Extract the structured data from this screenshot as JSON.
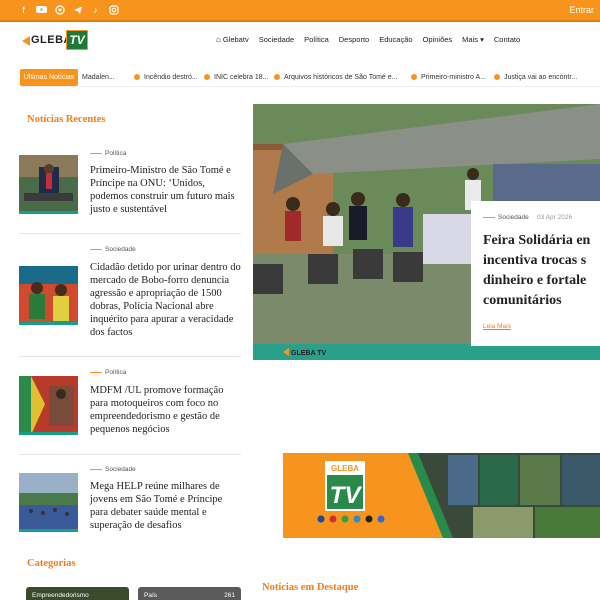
{
  "topbar": {
    "social_icons": [
      "facebook-icon",
      "youtube-icon",
      "whatsapp-icon",
      "telegram-icon",
      "tiktok-icon",
      "instagram-icon"
    ],
    "login": "Entrar"
  },
  "logo": {
    "word": "GLEBA",
    "tv": "TV"
  },
  "nav": {
    "items": [
      "Glebatv",
      "Sociedade",
      "Política",
      "Desporto",
      "Educação",
      "Opiniões",
      "Mais ▾",
      "Contato"
    ]
  },
  "ticker": {
    "label": "Últimas Notícias",
    "items": [
      "Madalen...",
      "Incêndio destró...",
      "INIC celebra 18...",
      "Arquivos históricos de São Tomé e...",
      "Primeiro-ministro A...",
      "Justiça vai ao encontr..."
    ]
  },
  "sidebar": {
    "recent_title": "Notícias Recentes",
    "items": [
      {
        "category": "Política",
        "title": "Primeiro-Ministro de São Tomé e Príncipe na ONU: ‘Unidos, podemos construir um futuro mais justo e sustentável"
      },
      {
        "category": "Sociedade",
        "title": "Cidadão detido por urinar dentro do mercado de Bobo-forro denuncia agressão e apropriação de 1500 dobras, Polícia Nacional abre inquérito para apurar a veracidade dos factos"
      },
      {
        "category": "Política",
        "title": "MDFM /UL promove formação para motoqueiros com foco no empreendedorismo e gestão de pequenos negócios"
      },
      {
        "category": "Sociedade",
        "title": "Mega HELP reúne milhares de jovens em São Tomé e Príncipe para debater saúde mental e superação de desafios"
      }
    ],
    "categories_title": "Categorias",
    "categories": [
      {
        "name": "Empreendedorismo",
        "count": ""
      },
      {
        "name": "País",
        "count": "261"
      }
    ]
  },
  "featured": {
    "category": "Sociedade",
    "date": "03 Apr 2026",
    "title_lines": [
      "Feira Solidária en",
      "incentiva trocas s",
      "dinheiro e fortale",
      "comunitários"
    ],
    "read_more": "Leia Mais",
    "watermark": "GLEBA TV"
  },
  "banner": {
    "word": "GLEBA",
    "tv": "TV"
  },
  "highlights_title": "Notícias em Destaque",
  "colors": {
    "accent": "#f7941d",
    "teal": "#16a08c",
    "brand_green": "#1f7a3a"
  }
}
